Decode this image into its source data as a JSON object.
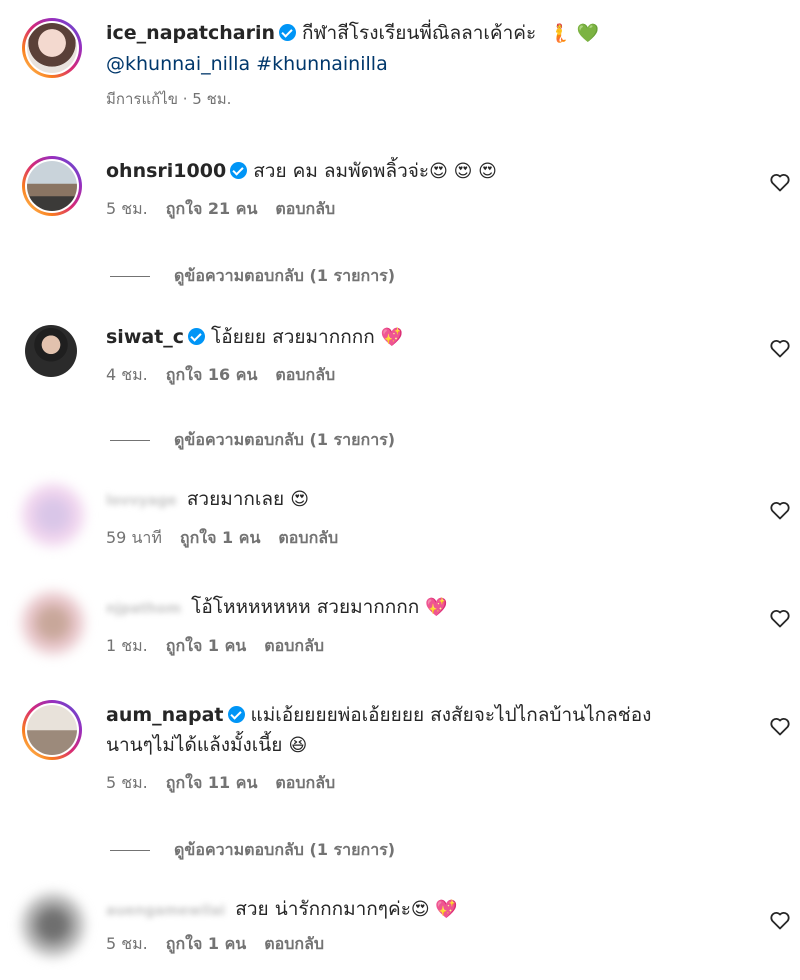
{
  "caption": {
    "username": "ice_napatcharin",
    "text": "กีฬาสีโรงเรียนพี่ณิลลาเค้าค่ะ",
    "emojis": "🧜 💚",
    "mention": "@khunnai_nilla",
    "hashtag": "#khunnainilla",
    "meta": "มีการแก้ไข · 5 ชม."
  },
  "comments": [
    {
      "username": "ohnsri1000",
      "text": "สวย คม ลมพัดพลิ้วจ่ะ",
      "emojis": "😍 😍 😍",
      "time": "5 ชม.",
      "likes": "ถูกใจ 21 คน",
      "reply": "ตอบกลับ",
      "view_replies": "ดูข้อความตอบกลับ (1 รายการ)"
    },
    {
      "username": "siwat_c",
      "text": "โอ้ยยย สวยมากกกก",
      "emojis": "💖",
      "time": "4 ชม.",
      "likes": "ถูกใจ 16 คน",
      "reply": "ตอบกลับ",
      "view_replies": "ดูข้อความตอบกลับ (1 รายการ)"
    },
    {
      "username": "lovvyage",
      "text": "สวยมากเลย",
      "emojis": "😍",
      "time": "59 นาที",
      "likes": "ถูกใจ 1 คน",
      "reply": "ตอบกลับ"
    },
    {
      "username": "njpathom",
      "text": "โอ้โหหหหหหห สวยมากกกก",
      "emojis": "💖",
      "time": "1 ชม.",
      "likes": "ถูกใจ 1 คน",
      "reply": "ตอบกลับ"
    },
    {
      "username": "aum_napat",
      "text": "แม่เอ้ยยยยพ่อเอ้ยยยย สงสัยจะไปไกลบ้านไกลช่อง",
      "text2": "นานๆไม่ได้แล้งมั้งเนี้ย",
      "emojis": "😆",
      "time": "5 ชม.",
      "likes": "ถูกใจ 11 คน",
      "reply": "ตอบกลับ",
      "view_replies": "ดูข้อความตอบกลับ (1 รายการ)"
    },
    {
      "username": "auengamewilai",
      "text": "สวย น่ารักกกมากๆค่ะ",
      "emojis": "😍 💖",
      "time": "5 ชม.",
      "likes": "ถูกใจ 1 คน",
      "reply": "ตอบกลับ"
    }
  ]
}
